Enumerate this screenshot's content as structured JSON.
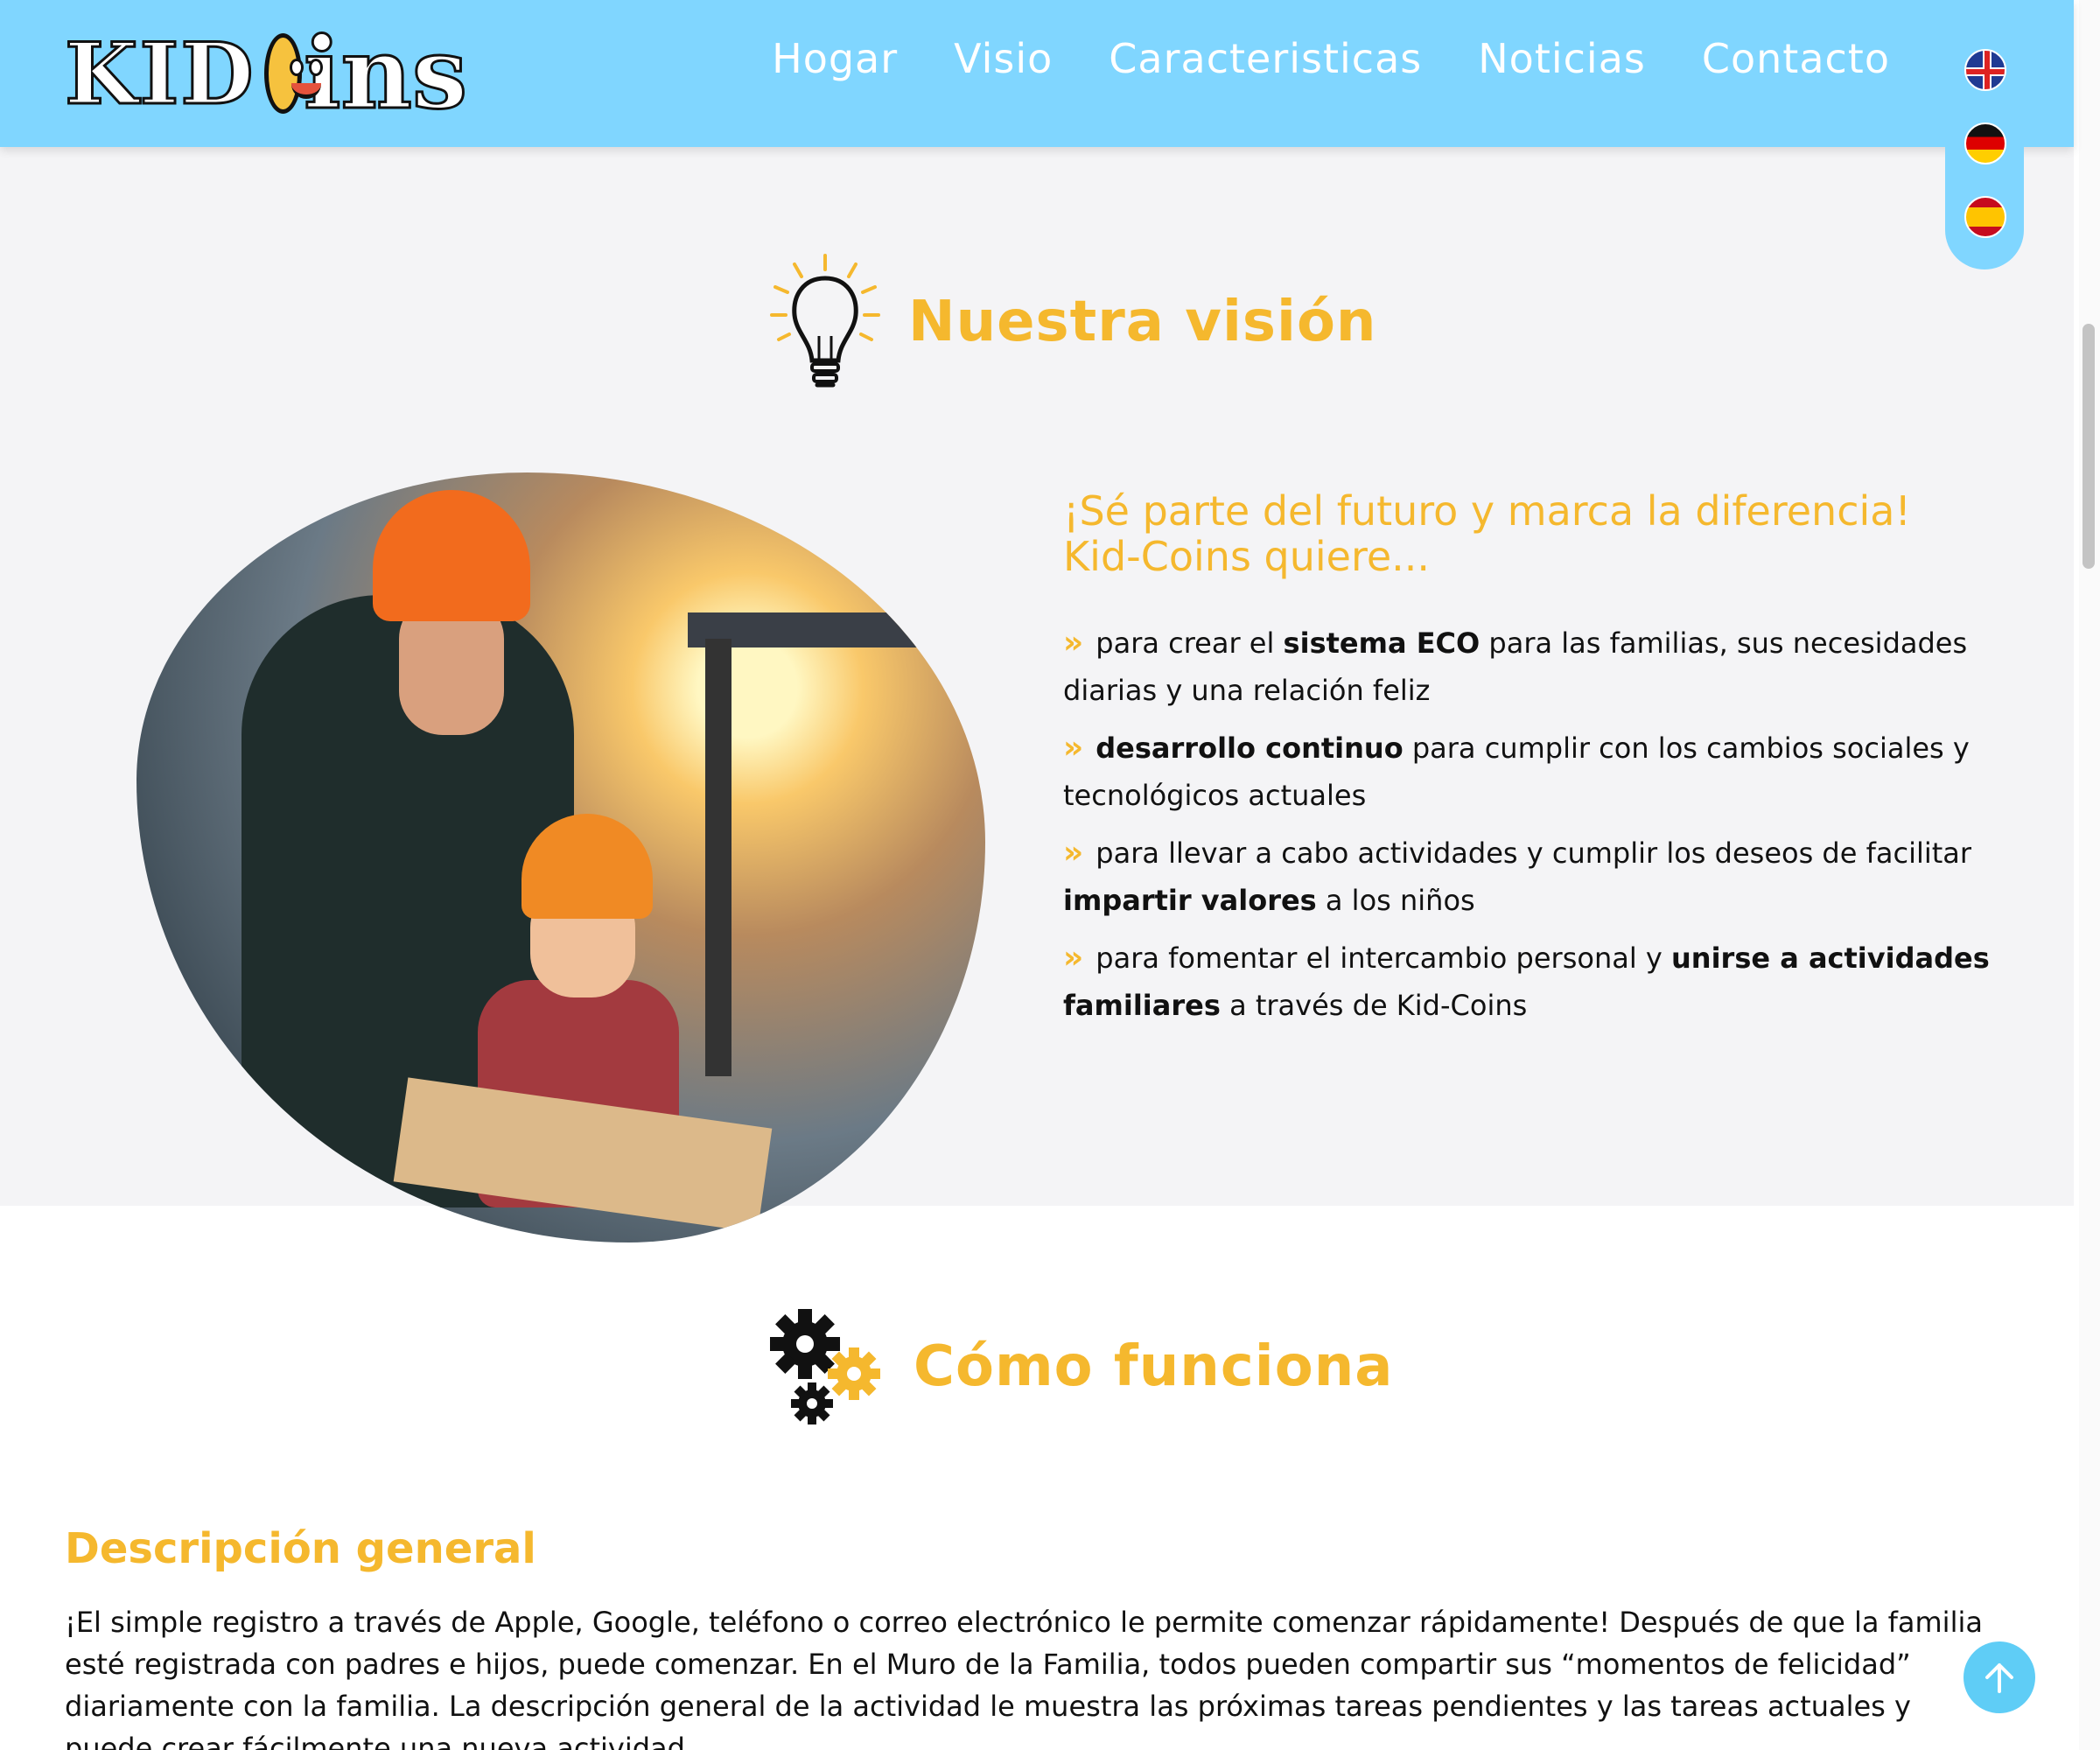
{
  "header": {
    "logo_text_left": "KID",
    "logo_text_right": "ins",
    "nav": [
      "Hogar",
      "Visio",
      "Caracteristicas",
      "Noticias",
      "Contacto"
    ],
    "accent": "#80d6ff"
  },
  "languages": [
    "uk-flag-icon",
    "germany-flag-icon",
    "spain-flag-icon"
  ],
  "vision": {
    "title": "Nuestra visión",
    "lead": "¡Sé parte del futuro y marca la diferencia! Kid-Coins quiere...",
    "points": [
      {
        "before": "para crear el ",
        "bold": "sistema ECO",
        "after": " para las familias, sus necesidades diarias y una relación feliz"
      },
      {
        "before": "",
        "bold": "desarrollo continuo",
        "after": " para cumplir con los cambios sociales y tecnológicos actuales"
      },
      {
        "before": "para llevar a cabo actividades y cumplir los deseos de facilitar ",
        "bold": "impartir valores",
        "after": " a los niños"
      },
      {
        "before": "para fomentar el intercambio personal y ",
        "bold": "unirse a actividades familiares",
        "after": " a través de Kid-Coins"
      }
    ],
    "marker": "»",
    "highlight_color": "#f5b82e"
  },
  "how": {
    "title": "Cómo funciona",
    "subheading": "Descripción general",
    "paragraph": "¡El simple registro a través de Apple, Google, teléfono o correo electrónico le permite comenzar rápidamente! Después de que la familia esté registrada con padres e hijos, puede comenzar. En el Muro de la Familia, todos pueden compartir sus “momentos de felicidad” diariamente con la familia. La descripción general de la actividad le muestra las próximas tareas pendientes y las tareas actuales y puede crear fácilmente una nueva actividad."
  }
}
